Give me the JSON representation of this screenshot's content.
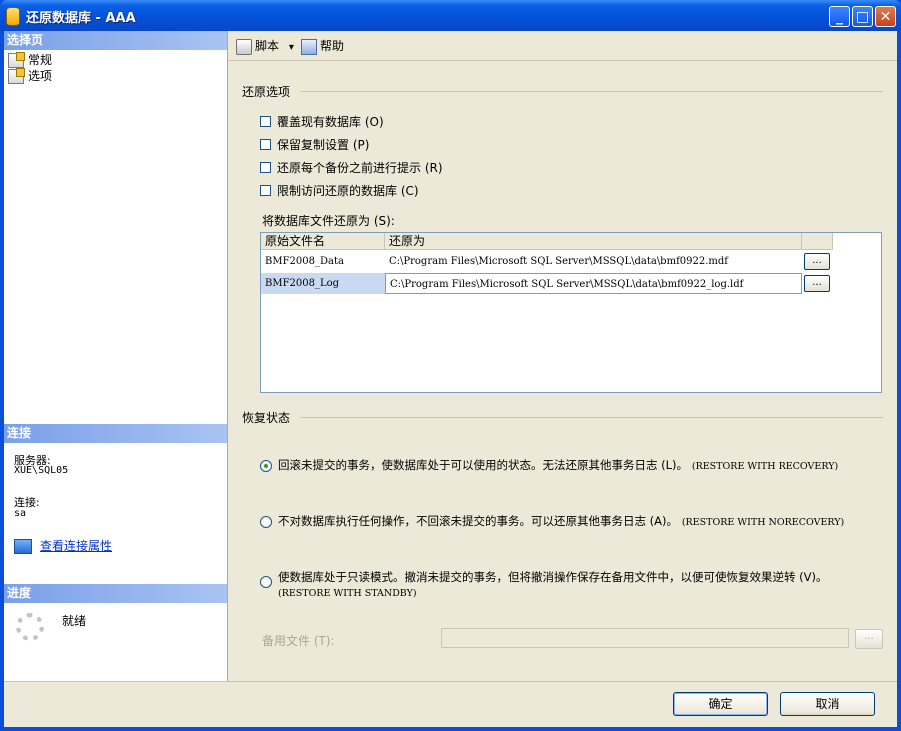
{
  "window": {
    "title": "还原数据库 - AAA",
    "minimize": "_",
    "maximize": "□",
    "close": "✕"
  },
  "left_pane": {
    "select_page_header": "选择页",
    "nav_items": [
      {
        "label": "常规"
      },
      {
        "label": "选项"
      }
    ],
    "connection_header": "连接",
    "server_label": "服务器:",
    "server_value": "XUE\\SQL05",
    "connection_label": "连接:",
    "connection_value": "sa",
    "view_properties_link": "查看连接属性",
    "progress_header": "进度",
    "progress_status": "就绪"
  },
  "toolbar": {
    "script_label": "脚本",
    "script_dropdown": "▾",
    "help_label": "帮助"
  },
  "restore_options": {
    "title": "还原选项",
    "checkboxes": [
      {
        "label": "覆盖现有数据库 (O)",
        "checked": false
      },
      {
        "label": "保留复制设置 (P)",
        "checked": false
      },
      {
        "label": "还原每个备份之前进行提示 (R)",
        "checked": false
      },
      {
        "label": "限制访问还原的数据库 (C)",
        "checked": false
      }
    ],
    "files_label": "将数据库文件还原为 (S):",
    "columns": [
      "原始文件名",
      "还原为"
    ],
    "rows": [
      {
        "original": "BMF2008_Data",
        "restore_as": "C:\\Program Files\\Microsoft SQL Server\\MSSQL\\data\\bmf0922.mdf",
        "browse": "..."
      },
      {
        "original": "BMF2008_Log",
        "restore_as": "C:\\Program Files\\Microsoft SQL Server\\MSSQL\\data\\bmf0922_log.ldf",
        "browse": "..."
      }
    ]
  },
  "recovery_state": {
    "title": "恢复状态",
    "options": [
      {
        "text": "回滚未提交的事务，使数据库处于可以使用的状态。无法还原其他事务日志 (L)。",
        "suffix": "(RESTORE WITH RECOVERY)",
        "selected": true
      },
      {
        "text": "不对数据库执行任何操作，不回滚未提交的事务。可以还原其他事务日志 (A)。",
        "suffix": "(RESTORE WITH NORECOVERY)",
        "selected": false
      },
      {
        "text": "使数据库处于只读模式。撤消未提交的事务，但将撤消操作保存在备用文件中，以便可使恢复效果逆转 (V)。",
        "suffix": "(RESTORE WITH STANDBY)",
        "selected": false
      }
    ],
    "standby_label": "备用文件 (T):",
    "standby_value": "",
    "standby_browse": "..."
  },
  "buttons": {
    "ok": "确定",
    "cancel": "取消"
  }
}
